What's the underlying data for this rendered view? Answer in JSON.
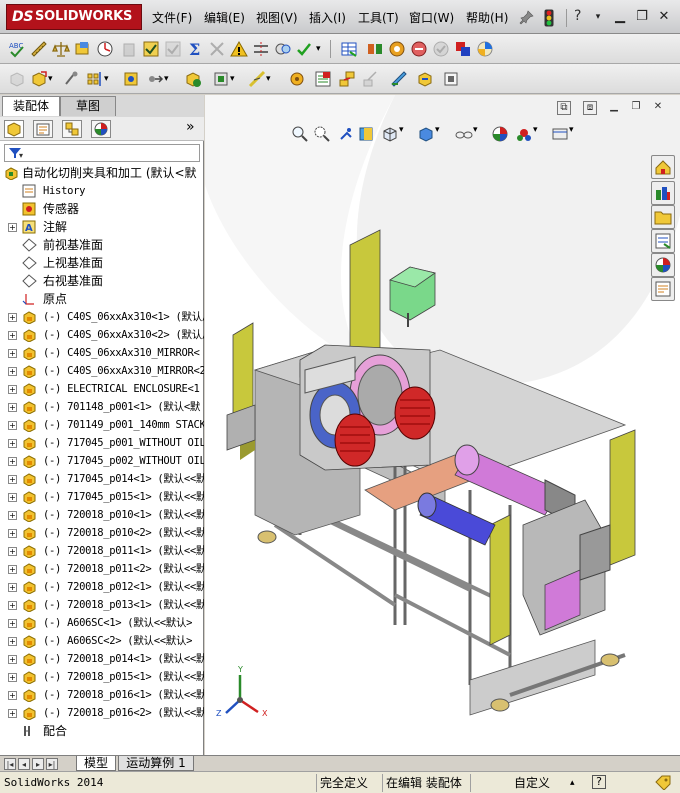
{
  "app": {
    "logo_text": "SOLIDWORKS",
    "logo_prefix": "DS"
  },
  "menubar": {
    "items": [
      "文件(F)",
      "编辑(E)",
      "视图(V)",
      "插入(I)",
      "工具(T)",
      "窗口(W)",
      "帮助(H)"
    ],
    "help_symbol": "?"
  },
  "left_pane": {
    "tabs": [
      "装配体",
      "草图"
    ],
    "expand_glyph": "»",
    "tree": [
      {
        "label": "自动化切削夹具和加工  (默认<默",
        "icon": "assembly-icon",
        "expand": "none",
        "kind": "root"
      },
      {
        "label": "History",
        "icon": "history-icon",
        "expand": "none",
        "kind": "feature"
      },
      {
        "label": "传感器",
        "icon": "sensor-icon",
        "expand": "none",
        "kind": "feature"
      },
      {
        "label": "注解",
        "icon": "annotation-icon",
        "expand": "+",
        "kind": "feature"
      },
      {
        "label": "前视基准面",
        "icon": "plane-icon",
        "expand": "none",
        "kind": "feature"
      },
      {
        "label": "上视基准面",
        "icon": "plane-icon",
        "expand": "none",
        "kind": "feature"
      },
      {
        "label": "右视基准面",
        "icon": "plane-icon",
        "expand": "none",
        "kind": "feature"
      },
      {
        "label": "原点",
        "icon": "origin-icon",
        "expand": "none",
        "kind": "feature"
      },
      {
        "label": "(-) C40S_06xxAx310<1> (默认/",
        "icon": "subassembly-icon",
        "expand": "+",
        "kind": "part"
      },
      {
        "label": "(-) C40S_06xxAx310<2> (默认/",
        "icon": "subassembly-icon",
        "expand": "+",
        "kind": "part"
      },
      {
        "label": "(-) C40S_06xxAx310_MIRROR<",
        "icon": "subassembly-icon",
        "expand": "+",
        "kind": "part"
      },
      {
        "label": "(-) C40S_06xxAx310_MIRROR<2",
        "icon": "subassembly-icon",
        "expand": "+",
        "kind": "part"
      },
      {
        "label": "(-) ELECTRICAL ENCLOSURE<1",
        "icon": "subassembly-icon",
        "expand": "+",
        "kind": "part"
      },
      {
        "label": "(-) 701148_p001<1> (默认<默",
        "icon": "subassembly-icon",
        "expand": "+",
        "kind": "part"
      },
      {
        "label": "(-) 701149_p001_140mm STACK",
        "icon": "subassembly-icon",
        "expand": "+",
        "kind": "part"
      },
      {
        "label": "(-) 717045_p001_WITHOUT OIL",
        "icon": "subassembly-icon",
        "expand": "+",
        "kind": "part"
      },
      {
        "label": "(-) 717045_p002_WITHOUT OIL",
        "icon": "subassembly-icon",
        "expand": "+",
        "kind": "part"
      },
      {
        "label": "(-) 717045_p014<1> (默认<<默",
        "icon": "subassembly-icon",
        "expand": "+",
        "kind": "part"
      },
      {
        "label": "(-) 717045_p015<1> (默认<<默",
        "icon": "subassembly-icon",
        "expand": "+",
        "kind": "part"
      },
      {
        "label": "(-) 720018_p010<1> (默认<<默",
        "icon": "subassembly-icon",
        "expand": "+",
        "kind": "part"
      },
      {
        "label": "(-) 720018_p010<2> (默认<<默",
        "icon": "subassembly-icon",
        "expand": "+",
        "kind": "part"
      },
      {
        "label": "(-) 720018_p011<1> (默认<<默",
        "icon": "subassembly-icon",
        "expand": "+",
        "kind": "part"
      },
      {
        "label": "(-) 720018_p011<2> (默认<<默",
        "icon": "subassembly-icon",
        "expand": "+",
        "kind": "part"
      },
      {
        "label": "(-) 720018_p012<1> (默认<<默",
        "icon": "subassembly-icon",
        "expand": "+",
        "kind": "part"
      },
      {
        "label": "(-) 720018_p013<1> (默认<<默",
        "icon": "subassembly-icon",
        "expand": "+",
        "kind": "part"
      },
      {
        "label": "(-) A606SC<1> (默认<<默认>",
        "icon": "subassembly-icon",
        "expand": "+",
        "kind": "part"
      },
      {
        "label": "(-) A606SC<2> (默认<<默认>",
        "icon": "subassembly-icon",
        "expand": "+",
        "kind": "part"
      },
      {
        "label": "(-) 720018_p014<1> (默认<<默",
        "icon": "subassembly-icon",
        "expand": "+",
        "kind": "part"
      },
      {
        "label": "(-) 720018_p015<1> (默认<<默",
        "icon": "subassembly-icon",
        "expand": "+",
        "kind": "part"
      },
      {
        "label": "(-) 720018_p016<1> (默认<<默",
        "icon": "subassembly-icon",
        "expand": "+",
        "kind": "part"
      },
      {
        "label": "(-) 720018_p016<2> (默认<<默",
        "icon": "subassembly-icon",
        "expand": "+",
        "kind": "part"
      },
      {
        "label": "配合",
        "icon": "mates-icon",
        "expand": "none",
        "kind": "feature"
      }
    ]
  },
  "bottom_tabs": {
    "model": "模型",
    "motion": "运动算例 1"
  },
  "status_bar": {
    "app_version": "SolidWorks 2014",
    "state": "完全定义",
    "editing": "在编辑 装配体",
    "custom": "自定义",
    "help_symbol": "?"
  },
  "viewport": {
    "axis_labels": {
      "x": "X",
      "y": "Y",
      "z": "Z"
    },
    "colors": {
      "frame": "#c8c8c8",
      "guard_yellow": "#c8c83c",
      "motor_red": "#d02828",
      "roller_magenta": "#d07ad8",
      "roller_blue": "#4a4ad8",
      "green_box": "#7ad88a",
      "salmon": "#e6a080",
      "gray_panel": "#b8b8b8"
    }
  }
}
